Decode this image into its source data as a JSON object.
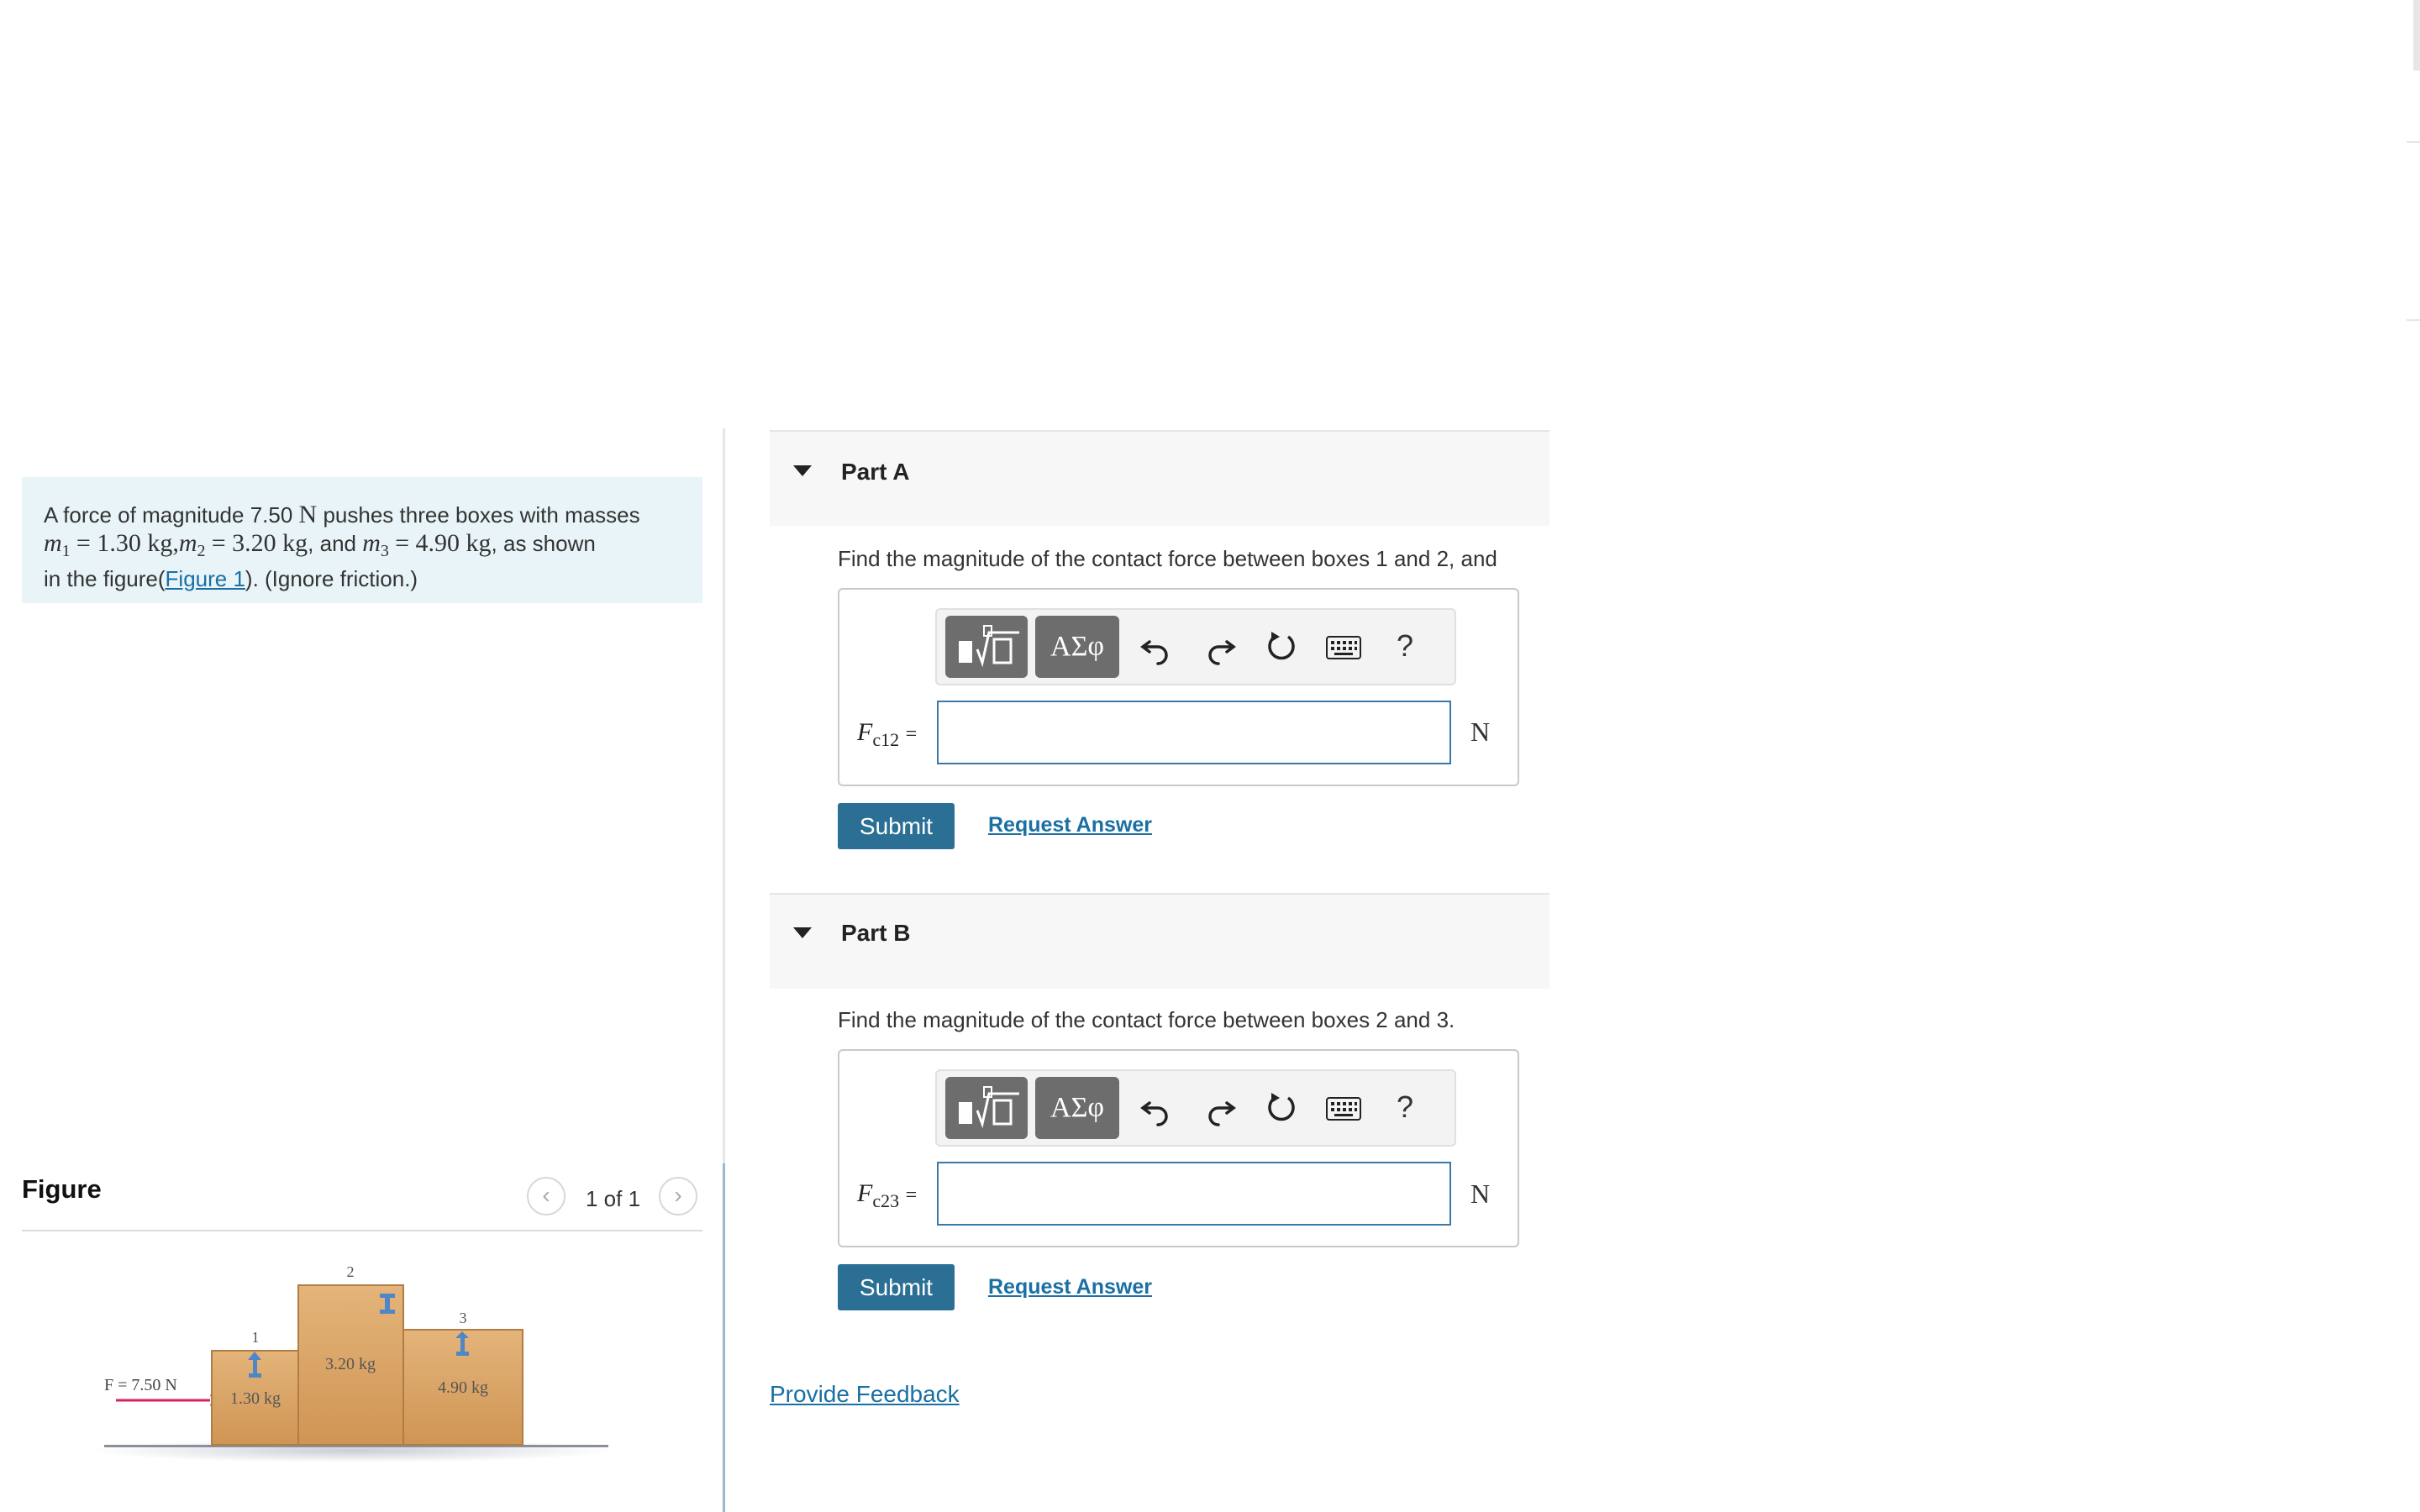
{
  "problem": {
    "intro": "A force of magnitude 7.50",
    "force_unit": "N",
    "mid1": "pushes three boxes with masses",
    "m1_sym": "m",
    "m1_sub": "1",
    "m1_val": "= 1.30 kg,",
    "m2_sym": "m",
    "m2_sub": "2",
    "m2_val": "= 3.20 kg",
    "and_text": ", and",
    "m3_sym": "m",
    "m3_sub": "3",
    "m3_val": "= 4.90 kg",
    "as_shown": ", as shown",
    "in_the_figure": "in the figure(",
    "figure_link": "Figure 1",
    "tail": "). (Ignore friction.)"
  },
  "figure": {
    "title": "Figure",
    "count": "1 of 1",
    "force_label": "F = 7.50 N",
    "boxes": [
      {
        "num": "1",
        "mass": "1.30 kg"
      },
      {
        "num": "2",
        "mass": "3.20 kg"
      },
      {
        "num": "3",
        "mass": "4.90 kg"
      }
    ]
  },
  "parts": [
    {
      "title": "Part A",
      "question": "Find the magnitude of the contact force between boxes 1 and 2, and",
      "var_symbol": "F",
      "var_sub": "c12",
      "equals": "=",
      "unit": "N",
      "submit": "Submit",
      "request": "Request Answer"
    },
    {
      "title": "Part B",
      "question": "Find the magnitude of the contact force between boxes 2 and 3.",
      "var_symbol": "F",
      "var_sub": "c23",
      "equals": "=",
      "unit": "N",
      "submit": "Submit",
      "request": "Request Answer"
    }
  ],
  "toolbar": {
    "greek_label": "ΑΣφ",
    "help_label": "?",
    "icons": [
      "templates-icon",
      "undo-icon",
      "redo-icon",
      "reset-icon",
      "keyboard-icon",
      "help-icon"
    ]
  },
  "feedback": "Provide Feedback",
  "colors": {
    "accent": "#2b6f95",
    "link": "#1a6fa3",
    "problem_bg": "#e8f4f7",
    "force_arrow": "#d6245a",
    "box_fill": "#dca86a"
  }
}
